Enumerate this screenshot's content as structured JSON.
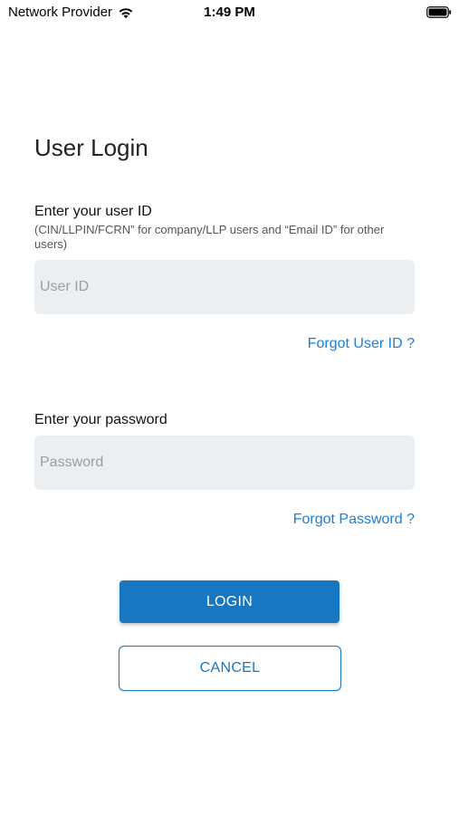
{
  "status_bar": {
    "carrier": "Network Provider",
    "time": "1:49 PM",
    "icons": [
      "wifi-icon",
      "battery-icon"
    ]
  },
  "login": {
    "title": "User Login",
    "userid": {
      "label": "Enter your user ID",
      "hint": "(CIN/LLPIN/FCRN” for company/LLP users and “Email ID” for other users)",
      "placeholder": "User ID",
      "value": "",
      "forgot_link": "Forgot User ID ?"
    },
    "password": {
      "label": "Enter your password",
      "placeholder": "Password",
      "value": "",
      "forgot_link": "Forgot Password ?"
    },
    "login_button": "LOGIN",
    "cancel_button": "CANCEL"
  },
  "colors": {
    "accent": "#1777c3",
    "link": "#1c7fd4",
    "input_background": "#eceff2"
  }
}
